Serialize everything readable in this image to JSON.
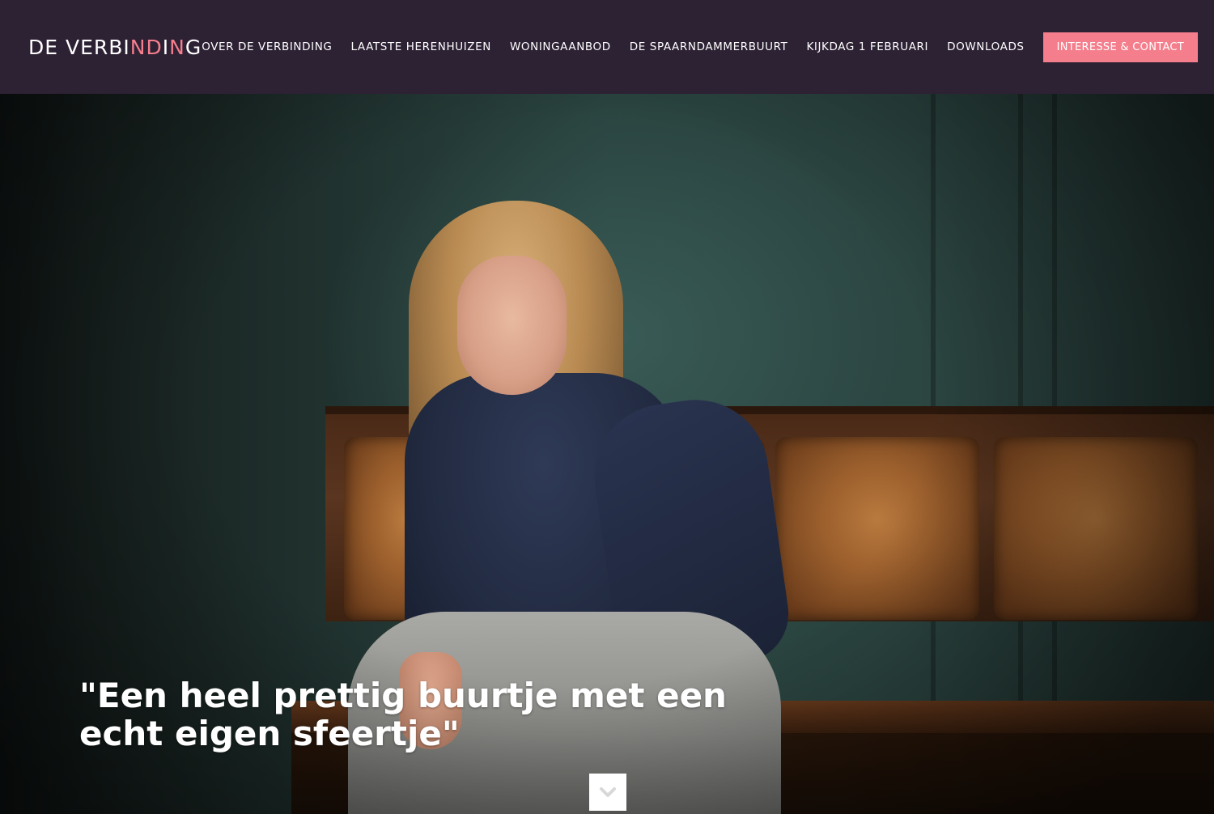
{
  "header": {
    "logo": {
      "prefix": "DE VERBI",
      "accent1": "ND",
      "middle": "I",
      "accent2": "N",
      "suffix": "G"
    },
    "nav": [
      {
        "label": "OVER DE VERBINDING"
      },
      {
        "label": "LAATSTE HERENHUIZEN"
      },
      {
        "label": "WONINGAANBOD"
      },
      {
        "label": "DE SPAARNDAMMERBUURT"
      },
      {
        "label": "KIJKDAG 1 FEBRUARI"
      },
      {
        "label": "DOWNLOADS"
      }
    ],
    "cta_label": "INTERESSE & CONTACT"
  },
  "hero": {
    "quote": "\"Een heel prettig buurtje met een echt eigen sfeertje\"",
    "scroll_icon": "chevron-down-icon"
  },
  "colors": {
    "header_bg": "#2d2134",
    "accent": "#f47e8c",
    "text": "#ffffff"
  }
}
